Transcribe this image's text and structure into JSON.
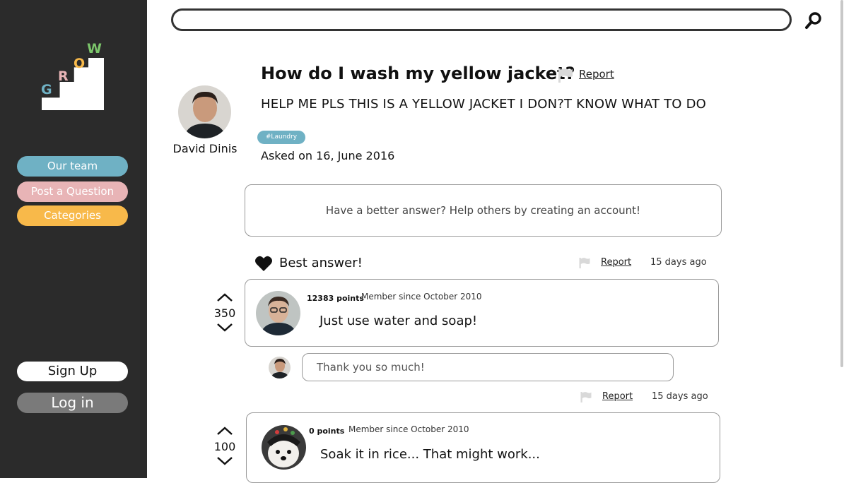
{
  "sidebar": {
    "logo_letters": [
      "G",
      "R",
      "O",
      "W"
    ],
    "nav": [
      {
        "label": "Our team",
        "color": "#6fb1c4"
      },
      {
        "label": "Post a Question",
        "color": "#e8b4b6"
      },
      {
        "label": "Categories",
        "color": "#f8b94a"
      }
    ],
    "sign_up": "Sign Up",
    "log_in": "Log in"
  },
  "search": {
    "value": "",
    "icon": "search-icon"
  },
  "question": {
    "title": "How do I wash my yellow jacket?",
    "report": "Report",
    "body": "HELP ME PLS THIS IS A YELLOW JACKET I DON?T KNOW WHAT TO DO",
    "tag": "#Laundry",
    "asked": "Asked on 16, June 2016",
    "author": "David Dinis"
  },
  "answer_prompt": "Have a better answer? Help others by creating an account!",
  "answers": [
    {
      "badge": "Best answer!",
      "report": "Report",
      "time": "15 days ago",
      "votes": "350",
      "points": "12383 points",
      "member_since": "Member since October 2010",
      "text": "Just use water and soap!",
      "comment": "Thank you so much!"
    },
    {
      "report": "Report",
      "time": "15 days ago",
      "votes": "100",
      "points": "0 points",
      "member_since": "Member since October 2010",
      "text": "Soak it in rice... That might work..."
    }
  ],
  "colors": {
    "sidebar": "#2b2b2b",
    "brand_blue": "#6fb1c4",
    "brand_pink": "#e8b4b6",
    "brand_yellow": "#f8b94a",
    "brand_green": "#7cc66b"
  }
}
